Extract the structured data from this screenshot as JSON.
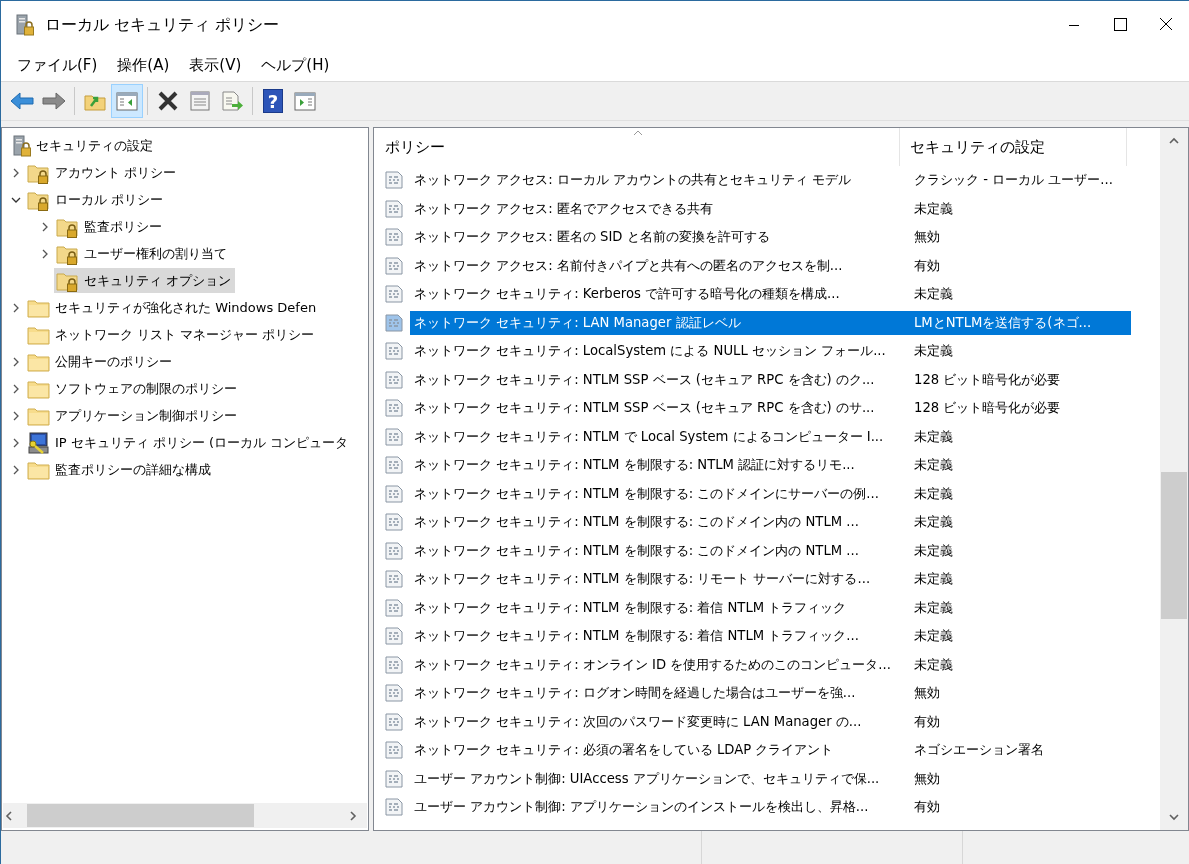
{
  "window": {
    "title": "ローカル セキュリティ ポリシー"
  },
  "menu": [
    "ファイル(F)",
    "操作(A)",
    "表示(V)",
    "ヘルプ(H)"
  ],
  "toolbar": [
    [
      {
        "kind": "back",
        "pressed": false
      },
      {
        "kind": "forward",
        "pressed": false
      }
    ],
    [
      {
        "kind": "up",
        "pressed": false
      },
      {
        "kind": "console-tree",
        "pressed": true
      }
    ],
    [
      {
        "kind": "delete",
        "pressed": false
      },
      {
        "kind": "properties",
        "pressed": false
      },
      {
        "kind": "export",
        "pressed": false
      }
    ],
    [
      {
        "kind": "help",
        "pressed": false,
        "glyph": "?"
      },
      {
        "kind": "action-pane",
        "pressed": false
      }
    ]
  ],
  "tree": {
    "label": "セキュリティの設定",
    "kind": "server",
    "selected": false,
    "children": [
      {
        "label": "アカウント ポリシー",
        "kind": "locked-folder",
        "expanded": false,
        "selected": false
      },
      {
        "label": "ローカル ポリシー",
        "kind": "locked-folder",
        "expanded": true,
        "selected": false,
        "children": [
          {
            "label": "監査ポリシー",
            "kind": "locked-folder",
            "expanded": false,
            "selected": false
          },
          {
            "label": "ユーザー権利の割り当て",
            "kind": "locked-folder",
            "expanded": false,
            "selected": false
          },
          {
            "label": "セキュリティ オプション",
            "kind": "locked-folder",
            "selected": true
          }
        ]
      },
      {
        "label": "セキュリティが強化された Windows Defen",
        "kind": "folder",
        "expanded": false,
        "selected": false
      },
      {
        "label": "ネットワーク リスト マネージャー ポリシー",
        "kind": "folder",
        "selected": false
      },
      {
        "label": "公開キーのポリシー",
        "kind": "folder",
        "expanded": false,
        "selected": false
      },
      {
        "label": "ソフトウェアの制限のポリシー",
        "kind": "folder",
        "expanded": false,
        "selected": false
      },
      {
        "label": "アプリケーション制御ポリシー",
        "kind": "folder",
        "expanded": false,
        "selected": false
      },
      {
        "label": "IP セキュリティ ポリシー (ローカル コンピュータ",
        "kind": "ip-security",
        "expanded": false,
        "selected": false
      },
      {
        "label": "監査ポリシーの詳細な構成",
        "kind": "folder",
        "expanded": false,
        "selected": false
      }
    ]
  },
  "table": {
    "columns": [
      "ポリシー",
      "セキュリティの設定"
    ],
    "rows": [
      {
        "policy": "ネットワーク アクセス: ローカル アカウントの共有とセキュリティ モデル",
        "setting": "クラシック - ローカル ユーザー...",
        "selected": false
      },
      {
        "policy": "ネットワーク アクセス: 匿名でアクセスできる共有",
        "setting": "未定義",
        "selected": false
      },
      {
        "policy": "ネットワーク アクセス: 匿名の SID と名前の変換を許可する",
        "setting": "無効",
        "selected": false
      },
      {
        "policy": "ネットワーク アクセス: 名前付きパイプと共有への匿名のアクセスを制...",
        "setting": "有効",
        "selected": false
      },
      {
        "policy": "ネットワーク セキュリティ: Kerberos で許可する暗号化の種類を構成...",
        "setting": "未定義",
        "selected": false
      },
      {
        "policy": "ネットワーク セキュリティ: LAN Manager 認証レベル",
        "setting": "LMとNTLMを送信する(ネゴ...",
        "selected": true
      },
      {
        "policy": "ネットワーク セキュリティ: LocalSystem による NULL セッション フォール...",
        "setting": "未定義",
        "selected": false
      },
      {
        "policy": "ネットワーク セキュリティ: NTLM SSP ベース (セキュア RPC を含む) のク...",
        "setting": "128 ビット暗号化が必要",
        "selected": false
      },
      {
        "policy": "ネットワーク セキュリティ: NTLM SSP ベース (セキュア RPC を含む) のサ...",
        "setting": "128 ビット暗号化が必要",
        "selected": false
      },
      {
        "policy": "ネットワーク セキュリティ: NTLM で Local System によるコンピューター I...",
        "setting": "未定義",
        "selected": false
      },
      {
        "policy": "ネットワーク セキュリティ: NTLM を制限する: NTLM 認証に対するリモ...",
        "setting": "未定義",
        "selected": false
      },
      {
        "policy": "ネットワーク セキュリティ: NTLM を制限する: このドメインにサーバーの例...",
        "setting": "未定義",
        "selected": false
      },
      {
        "policy": "ネットワーク セキュリティ: NTLM を制限する: このドメイン内の NTLM ...",
        "setting": "未定義",
        "selected": false
      },
      {
        "policy": "ネットワーク セキュリティ: NTLM を制限する: このドメイン内の NTLM ...",
        "setting": "未定義",
        "selected": false
      },
      {
        "policy": "ネットワーク セキュリティ: NTLM を制限する: リモート サーバーに対する...",
        "setting": "未定義",
        "selected": false
      },
      {
        "policy": "ネットワーク セキュリティ: NTLM を制限する: 着信 NTLM トラフィック",
        "setting": "未定義",
        "selected": false
      },
      {
        "policy": "ネットワーク セキュリティ: NTLM を制限する: 着信 NTLM トラフィック...",
        "setting": "未定義",
        "selected": false
      },
      {
        "policy": "ネットワーク セキュリティ: オンライン ID を使用するためのこのコンピュータ...",
        "setting": "未定義",
        "selected": false
      },
      {
        "policy": "ネットワーク セキュリティ: ログオン時間を経過した場合はユーザーを強...",
        "setting": "無効",
        "selected": false
      },
      {
        "policy": "ネットワーク セキュリティ: 次回のパスワード変更時に LAN Manager の...",
        "setting": "有効",
        "selected": false
      },
      {
        "policy": "ネットワーク セキュリティ: 必須の署名をしている LDAP クライアント",
        "setting": "ネゴシエーション署名",
        "selected": false
      },
      {
        "policy": "ユーザー アカウント制御: UIAccess アプリケーションで、セキュリティで保...",
        "setting": "無効",
        "selected": false
      },
      {
        "policy": "ユーザー アカウント制御: アプリケーションのインストールを検出し、昇格...",
        "setting": "有効",
        "selected": false
      }
    ]
  }
}
